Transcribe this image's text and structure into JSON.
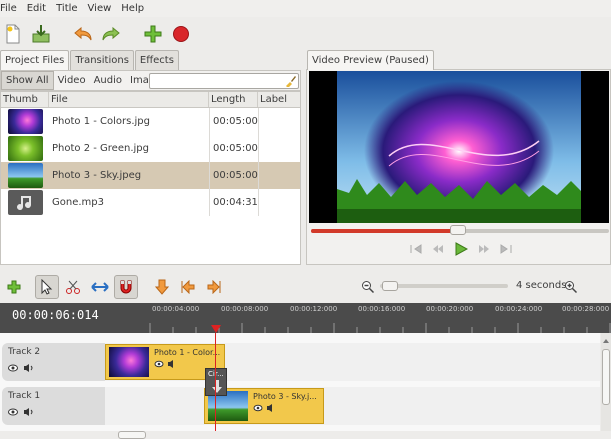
{
  "menu": [
    "File",
    "Edit",
    "Title",
    "View",
    "Help"
  ],
  "project": {
    "tabs": [
      "Project Files",
      "Transitions",
      "Effects"
    ],
    "filters": [
      "Show All",
      "Video",
      "Audio",
      "Image"
    ],
    "columns": [
      "Thumb",
      "File",
      "Length",
      "Label"
    ],
    "files": [
      {
        "name": "Photo 1 - Colors.jpg",
        "length": "00:05:00",
        "thumb": "colors"
      },
      {
        "name": "Photo 2 - Green.jpg",
        "length": "00:05:00",
        "thumb": "green"
      },
      {
        "name": "Photo 3 - Sky.jpeg",
        "length": "00:05:00",
        "thumb": "sky"
      },
      {
        "name": "Gone.mp3",
        "length": "00:04:31",
        "thumb": "music-note-icon"
      }
    ]
  },
  "preview": {
    "tab": "Video Preview (Paused)",
    "progress": 0.45
  },
  "timeline": {
    "zoom_label": "4 seconds",
    "timecode": "00:00:06:014",
    "ruler": [
      "00:00:04:000",
      "00:00:08:000",
      "00:00:12:000",
      "00:00:16:000",
      "00:00:20:000",
      "00:00:24:000",
      "00:00:28:000"
    ],
    "tracks": [
      {
        "name": "Track 2",
        "clip": "Photo 1 - Color..."
      },
      {
        "name": "Track 1",
        "clip": "Photo 3 - Sky.j..."
      }
    ],
    "transition_label": "Cir..."
  }
}
